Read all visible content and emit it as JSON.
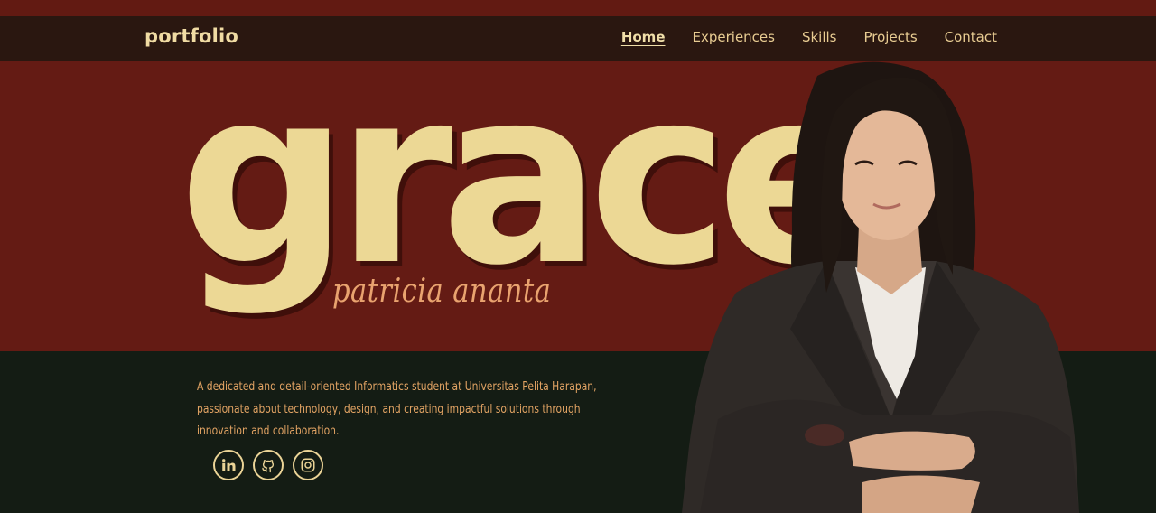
{
  "nav": {
    "logo": "portfolio",
    "links": [
      {
        "label": "Home",
        "active": true
      },
      {
        "label": "Experiences",
        "active": false
      },
      {
        "label": "Skills",
        "active": false
      },
      {
        "label": "Projects",
        "active": false
      },
      {
        "label": "Contact",
        "active": false
      }
    ]
  },
  "hero": {
    "first_name": "grace",
    "last_name": "patricia ananta",
    "description": "A dedicated and detail-oriented Informatics student at Universitas Pelita Harapan, passionate about technology, design, and creating impactful solutions through innovation and collaboration.",
    "socials": [
      {
        "icon": "linkedin-icon"
      },
      {
        "icon": "github-icon"
      },
      {
        "icon": "instagram-icon"
      }
    ]
  },
  "colors": {
    "maroon": "#641b14",
    "nav_bg": "#2a1710",
    "dark_green": "#141c14",
    "cream": "#ecd895",
    "orange_text": "#e3a464"
  }
}
